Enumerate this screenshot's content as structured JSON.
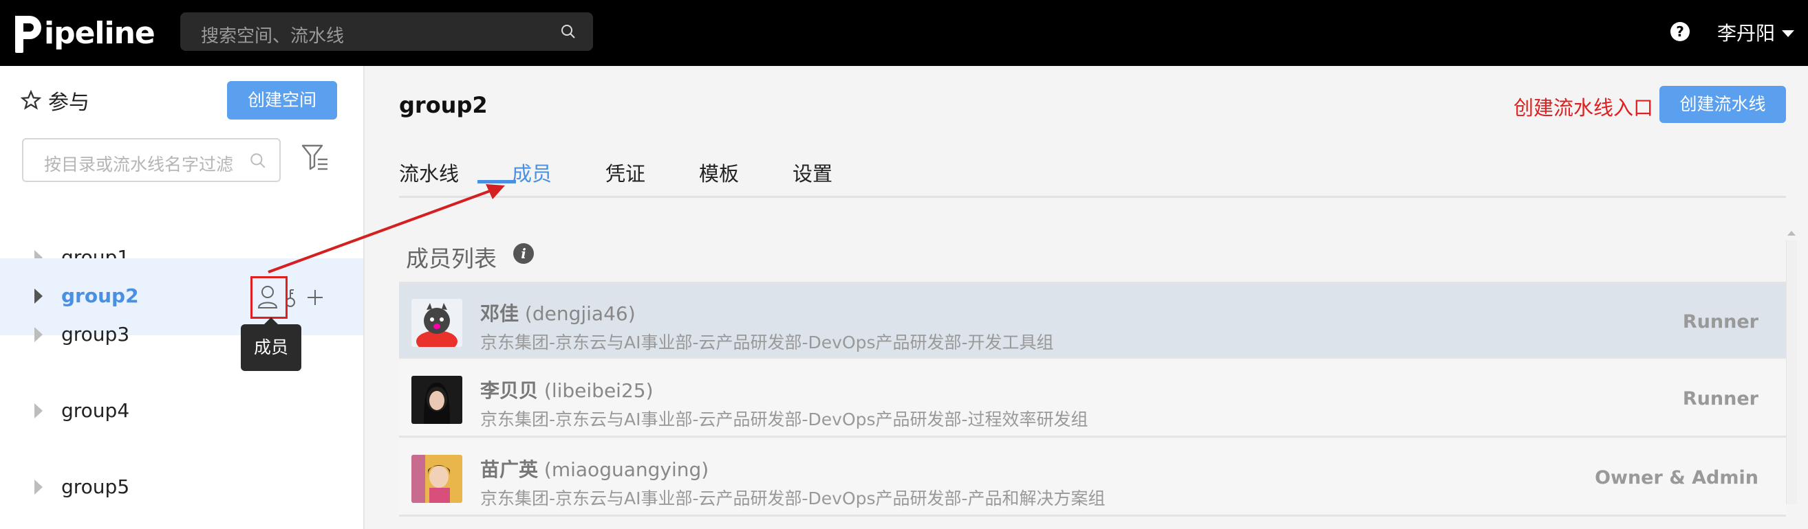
{
  "header": {
    "logo_text": "ipeline",
    "search_placeholder": "搜索空间、流水线",
    "help_glyph": "?",
    "user_name": "李丹阳"
  },
  "sidebar": {
    "favorites_label": "参与",
    "create_space_label": "创建空间",
    "filter_placeholder": "按目录或流水线名字过滤",
    "groups": [
      "group1",
      "group2",
      "group3",
      "group4",
      "group5"
    ],
    "active_group": "group2",
    "tooltip": "成员"
  },
  "main": {
    "title": "group2",
    "annotation": "创建流水线入口",
    "create_pipeline_label": "创建流水线",
    "tabs": [
      "流水线",
      "成员",
      "凭证",
      "模板",
      "设置"
    ],
    "active_tab": "成员",
    "section_title": "成员列表",
    "members": [
      {
        "name": "邓佳",
        "account": "(dengjia46)",
        "dept": "京东集团-京东云与AI事业部-云产品研发部-DevOps产品研发部-开发工具组",
        "role": "Runner"
      },
      {
        "name": "李贝贝",
        "account": "(libeibei25)",
        "dept": "京东集团-京东云与AI事业部-云产品研发部-DevOps产品研发部-过程效率研发组",
        "role": "Runner"
      },
      {
        "name": "苗广英",
        "account": "(miaoguangying)",
        "dept": "京东集团-京东云与AI事业部-云产品研发部-DevOps产品研发部-产品和解决方案组",
        "role": "Owner & Admin"
      }
    ]
  },
  "colors": {
    "accent": "#4a90e2",
    "button_blue": "#5aa0ef",
    "annotation_red": "#e02020",
    "header_bg": "#000000"
  }
}
